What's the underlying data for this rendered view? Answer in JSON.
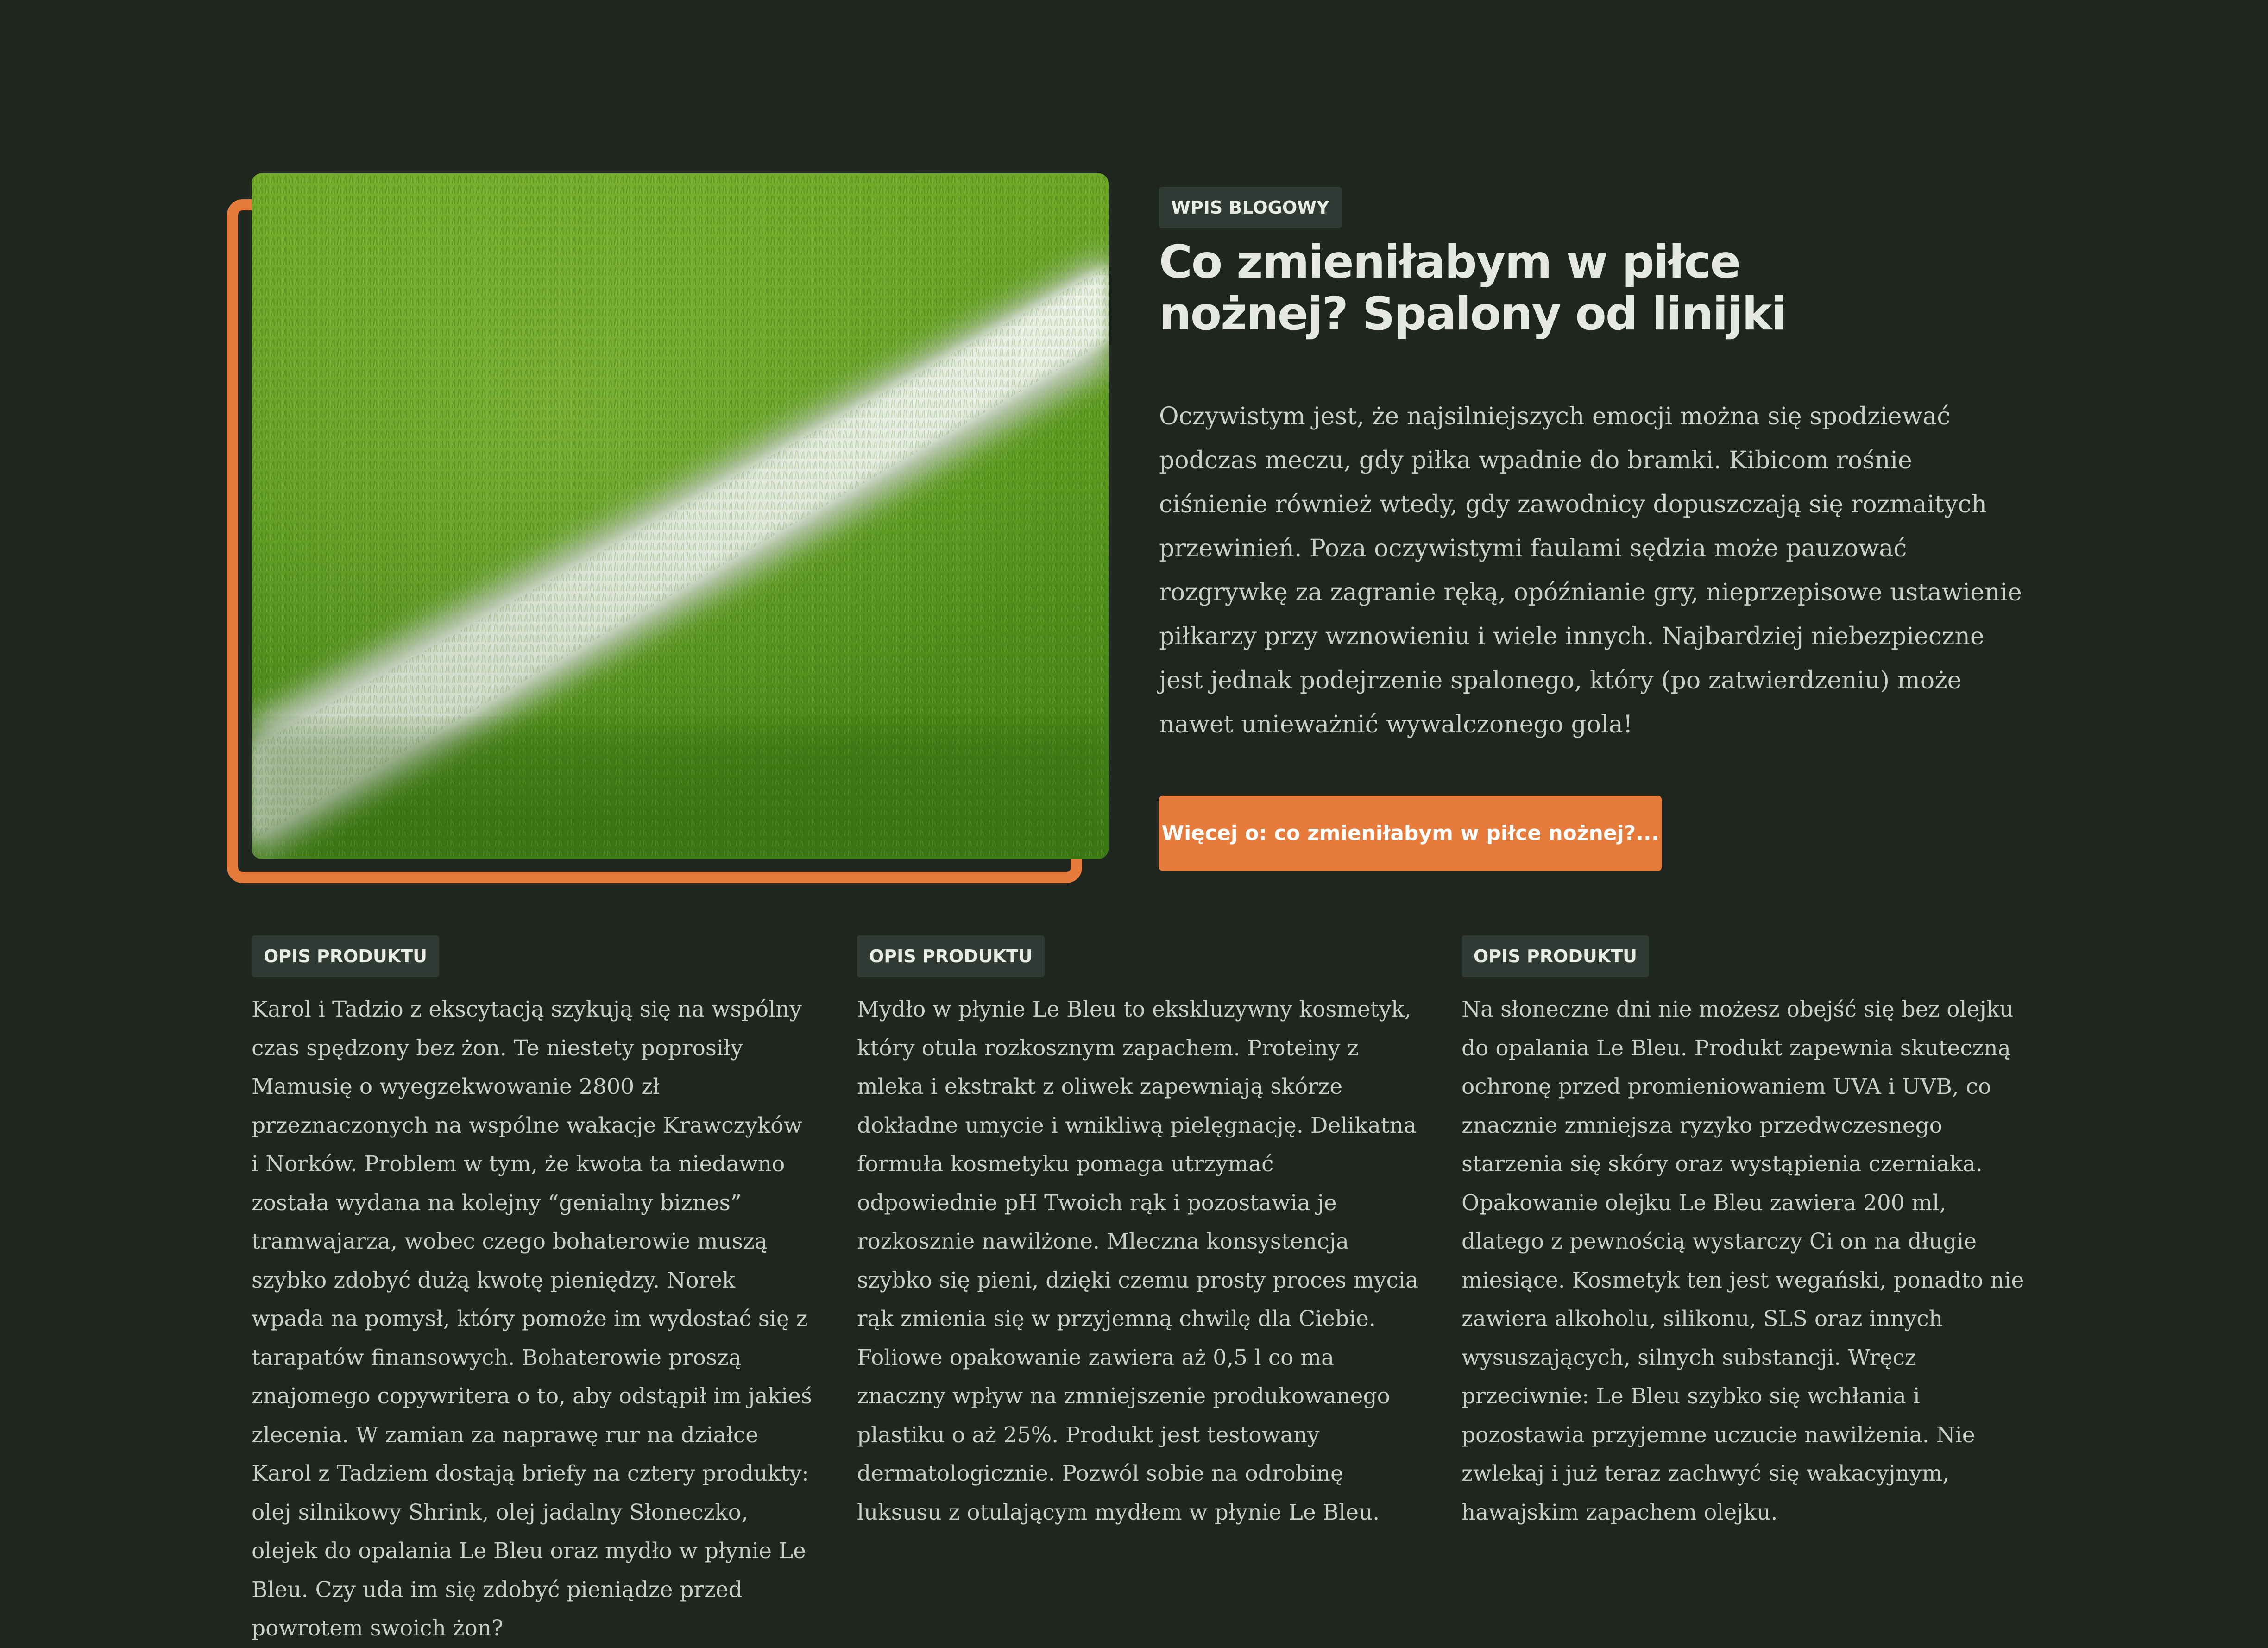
{
  "blog": {
    "badge": "WPIS BLOGOWY",
    "title": "Co zmieniłabym w piłce nożnej? Spalony od linijki",
    "text": "Oczywistym jest, że najsilniejszych emocji można się spodziewać podczas meczu, gdy piłka wpadnie do bramki. Kibicom rośnie ciśnienie również wtedy, gdy zawodnicy dopuszczają się rozmaitych przewinień. Poza oczywistymi faulami sędzia może pauzować rozgrywkę za zagranie ręką, opóźnianie gry, nieprzepisowe ustawienie piłkarzy przy wznowieniu i wiele innych. Najbardziej niebezpieczne jest jednak podejrzenie spalonego, który (po zatwierdzeniu) może nawet unieważnić wywalczonego gola!",
    "button_label": "Więcej o: co zmieniłabym w piłce nożnej?..."
  },
  "colors": {
    "background": "#1f2620",
    "accent": "#e77b3c",
    "badge_bg": "#2e3a33",
    "text": "#c9cfc6",
    "heading": "#e6e9e1"
  },
  "products": [
    {
      "badge": "OPIS PRODUKTU",
      "text": "Karol i Tadzio z ekscytacją szykują się na wspólny czas spędzony bez żon. Te niestety poprosiły Mamusię o wyegzekwowanie 2800 zł przeznaczonych na wspólne wakacje Krawczyków i Norków. Problem w tym, że kwota ta niedawno została wydana na kolejny “genialny biznes” tramwajarza, wobec czego bohaterowie muszą szybko zdobyć dużą kwotę pieniędzy. Norek wpada na pomysł, który pomoże im wydostać się z tarapatów finansowych. Bohaterowie proszą znajomego copywritera o to, aby odstąpił im jakieś zlecenia. W zamian za naprawę rur na działce Karol z Tadziem dostają briefy na cztery produkty: olej silnikowy Shrink, olej jadalny Słoneczko, olejek do opalania Le Bleu oraz mydło w płynie Le Bleu. Czy uda im się zdobyć pieniądze przed powrotem swoich żon?"
    },
    {
      "badge": "OPIS PRODUKTU",
      "text": "Mydło w płynie Le Bleu to ekskluzywny kosmetyk, który otula rozkosznym zapachem. Proteiny z mleka i ekstrakt z oliwek zapewniają skórze dokładne umycie i wnikliwą pielęgnację. Delikatna formuła kosmetyku pomaga utrzymać odpowiednie pH Twoich rąk i pozostawia je rozkosznie nawilżone. Mleczna konsystencja szybko się pieni, dzięki czemu prosty proces mycia rąk zmienia się w przyjemną chwilę dla Ciebie. Foliowe opakowanie zawiera aż 0,5 l co ma znaczny wpływ na zmniejszenie produkowanego plastiku o aż 25%. Produkt jest testowany dermatologicznie. Pozwól sobie na odrobinę luksusu z otulającym mydłem w płynie Le Bleu."
    },
    {
      "badge": "OPIS PRODUKTU",
      "text": "Na słoneczne dni nie możesz obejść się bez olejku do opalania Le Bleu. Produkt zapewnia skuteczną ochronę przed promieniowaniem UVA i UVB, co znacznie zmniejsza ryzyko przedwczesnego starzenia się skóry oraz wystąpienia czerniaka. Opakowanie olejku Le Bleu zawiera 200 ml, dlatego z pewnością wystarczy Ci on na długie miesiące. Kosmetyk ten jest wegański, ponadto nie zawiera alkoholu, silikonu, SLS oraz innych wysuszających, silnych substancji. Wręcz przeciwnie: Le Bleu szybko się wchłania i pozostawia przyjemne uczucie nawilżenia. Nie zwlekaj i już teraz zachwyć się wakacyjnym, hawajskim zapachem olejku."
    }
  ]
}
